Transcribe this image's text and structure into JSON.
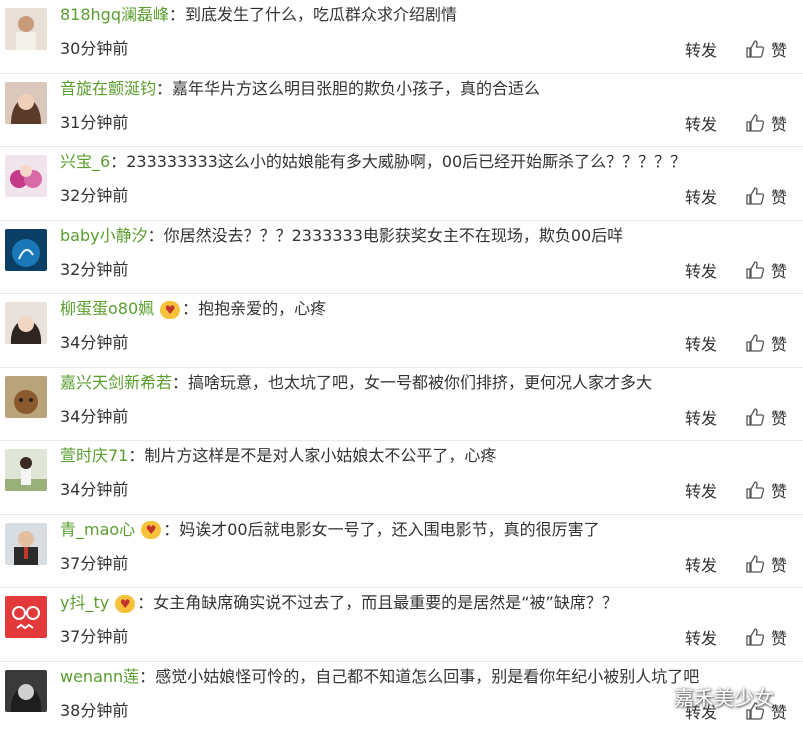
{
  "actions": {
    "repost_label": "转发",
    "like_label": "赞"
  },
  "comments": [
    {
      "username": "818hgq澜磊峰",
      "text": "到底发生了什么，吃瓜群众求介绍剧情",
      "time": "30分钟前"
    },
    {
      "username": "音旋在颤涎钧",
      "text": "嘉年华片方这么明目张胆的欺负小孩子，真的合适么",
      "time": "31分钟前"
    },
    {
      "username": "兴宝_6",
      "text": "233333333这么小的姑娘能有多大威胁啊，00后已经开始厮杀了么？？？？？",
      "time": "32分钟前"
    },
    {
      "username": "baby小静汐",
      "text": "你居然没去？？？2333333电影获奖女主不在现场，欺负00后咩",
      "time": "32分钟前"
    },
    {
      "username": "柳蛋蛋o80姵",
      "text": "抱抱亲爱的，心疼",
      "time": "34分钟前"
    },
    {
      "username": "嘉兴天剑新希若",
      "text": "搞啥玩意，也太坑了吧，女一号都被你们排挤，更何况人家才多大",
      "time": "34分钟前"
    },
    {
      "username": "萱时庆71",
      "text": "制片方这样是不是对人家小姑娘太不公平了，心疼",
      "time": "34分钟前"
    },
    {
      "username": "青_mao心",
      "text": "妈诶才00后就电影女一号了，还入围电影节，真的很厉害了",
      "time": "37分钟前"
    },
    {
      "username": "y抖_ty",
      "text": "女主角缺席确实说不过去了，而且最重要的是居然是“被”缺席？？",
      "time": "37分钟前"
    },
    {
      "username": "wenann莲",
      "text": "感觉小姑娘怪可怜的，自己都不知道怎么回事，别是看你年纪小被别人坑了吧",
      "time": "38分钟前"
    }
  ],
  "watermark": {
    "text": "嘉禾美少女"
  },
  "colors": {
    "username": "#5a9e2e",
    "badge": "#f7c23a",
    "divider": "#e8e8e8"
  }
}
